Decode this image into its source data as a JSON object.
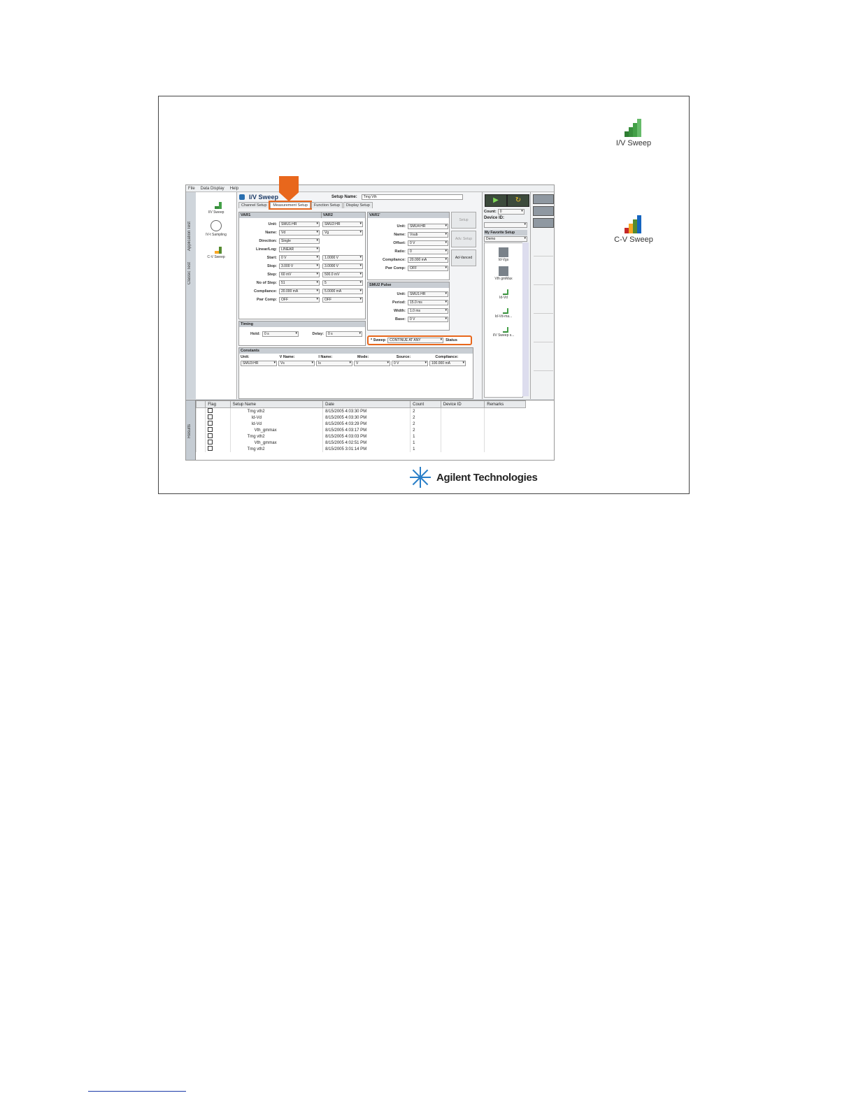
{
  "desktop_icons": [
    {
      "label": "I/V Sweep"
    },
    {
      "label": "C-V Sweep"
    }
  ],
  "menu": [
    "File",
    "Data Display",
    "Help"
  ],
  "left_tabs": [
    "Application Test",
    "Classic Test"
  ],
  "launcher": [
    "I/V Sweep",
    "IV-t Sampling",
    "C-V Sweep"
  ],
  "app_title": "I/V Sweep",
  "setup_name_label": "Setup Name:",
  "setup_name_value": "Tmg Vth",
  "tabs": [
    "Channel Setup",
    "Measurement Setup",
    "Function Setup",
    "Display Setup"
  ],
  "var1": {
    "header": "VAR1",
    "rows": [
      {
        "label": "Unit:",
        "value": "SMU1:HR"
      },
      {
        "label": "Name:",
        "value": "Vd"
      },
      {
        "label": "Direction:",
        "value": "Single"
      },
      {
        "label": "Linear/Log:",
        "value": "LINEAR"
      },
      {
        "label": "Start:",
        "value": "0 V"
      },
      {
        "label": "Stop:",
        "value": "3.000 V"
      },
      {
        "label": "Step:",
        "value": "60 mV"
      },
      {
        "label": "No of Step:",
        "value": "51"
      },
      {
        "label": "Compliance:",
        "value": "20.000 mA"
      },
      {
        "label": "Pwr Comp:",
        "value": "OFF"
      }
    ]
  },
  "var2": {
    "header": "VAR2",
    "values": [
      "SMU2:HR",
      "Vg",
      "",
      "",
      "1.0000 V",
      "3.0000 V",
      "500.0 mV",
      "5",
      "5.0000 mA",
      "OFF"
    ]
  },
  "var1p": {
    "header": "VAR1'",
    "rows": [
      {
        "label": "Unit:",
        "value": "SMU4:HR"
      },
      {
        "label": "Name:",
        "value": "Vsub"
      },
      {
        "label": "Offset:",
        "value": "0 V"
      },
      {
        "label": "Ratio:",
        "value": "0"
      },
      {
        "label": "Compliance:",
        "value": "20.000 mA"
      },
      {
        "label": "Pwr Comp:",
        "value": "OFF"
      }
    ]
  },
  "pulse": {
    "header": "SMU2 Pulse",
    "rows": [
      {
        "label": "Unit:",
        "value": "SMU1:HR"
      },
      {
        "label": "Period:",
        "value": "15.0 ms"
      },
      {
        "label": "Width:",
        "value": "1.0 ms"
      },
      {
        "label": "Base:",
        "value": "0 V"
      }
    ]
  },
  "side_buttons": [
    "Setup",
    "Adv. Setup",
    "Ad-Vanced"
  ],
  "timing": {
    "header": "Timing",
    "hold_label": "Hold:",
    "hold": "0 s",
    "delay_label": "Delay:",
    "delay": "0 s"
  },
  "sweep": {
    "label": "* Sweep",
    "value": "CONTINUE AT ANY",
    "status": "Status"
  },
  "constants": {
    "header": "Constants",
    "cols": [
      "Unit:",
      "V Name:",
      "I Name:",
      "Mode:",
      "Source:",
      "Compliance:"
    ],
    "values": [
      "SMU3:HR",
      "Vs",
      "Is",
      "V",
      "0 V",
      "100.000 mA"
    ]
  },
  "right_panel": {
    "count_label": "Count:",
    "count": "0",
    "device_label": "Device ID:",
    "fav_label": "My Favorite Setup",
    "fav_value": "Demo",
    "items": [
      "Id-Vgs",
      "Vth gmMax",
      "Id-Vd",
      "Id-Vd-ma...",
      "I/V Sweep s..."
    ]
  },
  "results": {
    "side_label": "Results",
    "columns": [
      "Flag",
      "Setup Name",
      "Date",
      "Count",
      "Device ID",
      "Remarks"
    ],
    "rows": [
      {
        "name": "Tmg vth2",
        "date": "8/15/2005 4:03:30 PM",
        "count": "2"
      },
      {
        "name": "Id-Vd",
        "date": "8/15/2005 4:03:30 PM",
        "count": "2"
      },
      {
        "name": "Id-Vd",
        "date": "8/15/2005 4:03:29 PM",
        "count": "2"
      },
      {
        "name": "Vth_gmmax",
        "date": "8/15/2005 4:03:17 PM",
        "count": "2"
      },
      {
        "name": "Tmg vth2",
        "date": "8/15/2005 4:03:03 PM",
        "count": "1"
      },
      {
        "name": "Vth_gmmax",
        "date": "8/15/2005 4:02:51 PM",
        "count": "1"
      },
      {
        "name": "Tmg vth2",
        "date": "8/15/2005 3:01:14 PM",
        "count": "1"
      }
    ]
  },
  "logo_text": "Agilent Technologies",
  "colors": {
    "highlight": "#e8671c",
    "run": "#7ed957"
  }
}
